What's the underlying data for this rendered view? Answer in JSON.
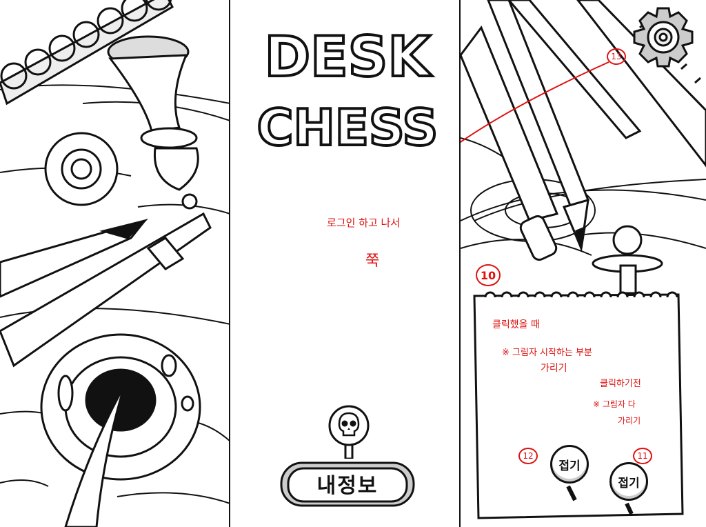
{
  "app": {
    "title_line1": "DESK",
    "title_line2": "CHESS"
  },
  "main": {
    "my_info_button_label": "내정보"
  },
  "annotations": {
    "login_note_line1": "로그인 하고 나서",
    "login_note_line2": "쭉",
    "marker_13": "13",
    "marker_10": "10",
    "marker_12": "12",
    "marker_11": "11",
    "clicked_line1": "클릭했을 때",
    "clicked_line2": "※ 그림자 시작하는 부분",
    "clicked_line3": "가리기",
    "before_click_line1": "클릭하기전",
    "before_click_line2": "※ 그림자 다",
    "before_click_line3": "가리기"
  },
  "notepad": {
    "fold_button_label_12": "접기",
    "fold_button_label_11": "접기"
  },
  "icons": {
    "settings": "gear-icon",
    "skull": "skull-icon"
  },
  "colors": {
    "ink": "#111111",
    "annotation": "#e01010",
    "background": "#ffffff"
  }
}
